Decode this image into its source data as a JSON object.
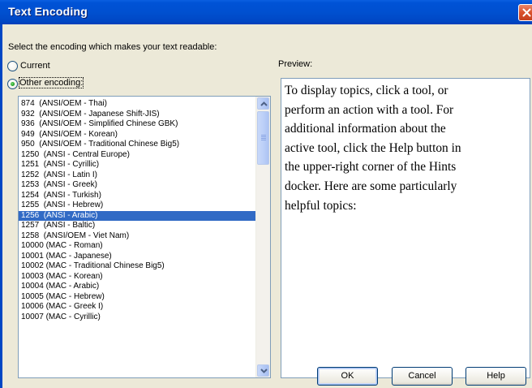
{
  "window": {
    "title": "Text Encoding"
  },
  "instruction": "Select the encoding which makes your text readable:",
  "radios": {
    "current_label": "Current",
    "other_label": "Other encoding:",
    "selected": "other"
  },
  "preview_label": "Preview:",
  "encodings": {
    "items": [
      "874  (ANSI/OEM - Thai)",
      "932  (ANSI/OEM - Japanese Shift-JIS)",
      "936  (ANSI/OEM - Simplified Chinese GBK)",
      "949  (ANSI/OEM - Korean)",
      "950  (ANSI/OEM - Traditional Chinese Big5)",
      "1250  (ANSI - Central Europe)",
      "1251  (ANSI - Cyrillic)",
      "1252  (ANSI - Latin I)",
      "1253  (ANSI - Greek)",
      "1254  (ANSI - Turkish)",
      "1255  (ANSI - Hebrew)",
      "1256  (ANSI - Arabic)",
      "1257  (ANSI - Baltic)",
      "1258  (ANSI/OEM - Viet Nam)",
      "10000 (MAC - Roman)",
      "10001 (MAC - Japanese)",
      "10002 (MAC - Traditional Chinese Big5)",
      "10003 (MAC - Korean)",
      "10004 (MAC - Arabic)",
      "10005 (MAC - Hebrew)",
      "10006 (MAC - Greek I)",
      "10007 (MAC - Cyrillic)"
    ],
    "selected_index": 11
  },
  "preview": {
    "lines": [
      "To display topics, click a tool, or",
      "perform an action with a tool. For",
      "additional information about the",
      "active tool, click the Help button in",
      "the upper-right corner of the Hints",
      "docker. Here are some particularly",
      "helpful topics:"
    ]
  },
  "buttons": {
    "ok": "OK",
    "cancel": "Cancel",
    "help": "Help"
  },
  "colors": {
    "titlebar": "#0050d0",
    "selection": "#316ac5",
    "dialog_face": "#ece9d8",
    "close_button": "#d9502c"
  },
  "icons": {
    "close": "close-icon",
    "scroll_up": "chevron-up-icon",
    "scroll_down": "chevron-down-icon"
  }
}
